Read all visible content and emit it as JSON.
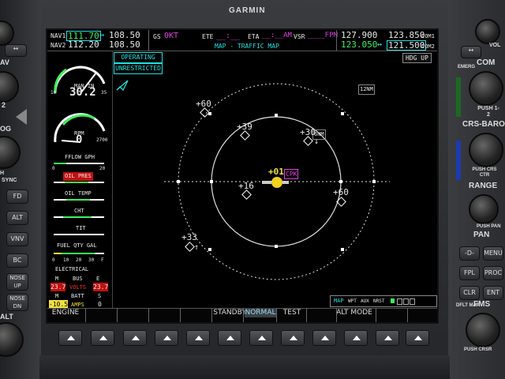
{
  "bezel": {
    "brand": "GARMIN",
    "left_knob_labels": [
      "AV",
      "2",
      "OG",
      "H",
      "SYNC",
      "ALT"
    ],
    "left_buttons": [
      "FD",
      "ALT",
      "VNV",
      "BC",
      "NOSE UP",
      "NOSE DN"
    ],
    "right_labels": {
      "vol": "VOL",
      "com": "COM",
      "emerg": "EMERG",
      "push_1_2": "PUSH 1-2",
      "crs_baro": "CRS-BARO",
      "push_crs_ctr": "PUSH CRS CTR",
      "range": "RANGE",
      "push_pan": "PUSH PAN",
      "fms": "FMS",
      "dflt_map": "DFLT MAP",
      "push_crsr": "PUSH CRSR"
    },
    "right_buttons": [
      "-D-",
      "MENU",
      "FPL",
      "PROC",
      "CLR",
      "ENT"
    ]
  },
  "topbar": {
    "nav1_label": "NAV1",
    "nav1_active": "111.70",
    "nav1_standby": "108.50",
    "nav2_label": "NAV2",
    "nav2_active": "112.20",
    "nav2_standby": "108.50",
    "gs_label": "GS",
    "gs_value": "0KT",
    "ete_label": "ETE",
    "ete_value": "__:__",
    "eta_label": "ETA",
    "eta_value": "__:__AM",
    "vsr_label": "VSR",
    "vsr_value": "____FPM",
    "com1_active": "127.900",
    "com1_standby": "123.850",
    "com1_label": "COM1",
    "com2_active": "123.050",
    "com2_standby": "121.500",
    "com2_label": "COM2",
    "map_title": "MAP - TRAFFIC MAP",
    "orientation": "HDG UP",
    "swap_arrow": "↔"
  },
  "traffic": {
    "status_operating": "OPERATING",
    "status_unrestricted": "UNRESTRICTED",
    "range_outer": "12NM",
    "range_inner": "6NM",
    "ownship_label": "+01",
    "ownship_id": "CPK",
    "targets": [
      {
        "alt": "+60",
        "arrow": ""
      },
      {
        "alt": "+39",
        "arrow": ""
      },
      {
        "alt": "+30",
        "arrow": "↓"
      },
      {
        "alt": "+16",
        "arrow": ""
      },
      {
        "alt": "+60",
        "arrow": ""
      },
      {
        "alt": "+33",
        "arrow": "↑"
      }
    ]
  },
  "eis": {
    "man_in_label": "MAN IN",
    "man_in_value": "30.2",
    "man_scale_min": "10",
    "man_scale_max": "35",
    "rpm_label": "RPM",
    "rpm_value": "0",
    "rpm_scale_max": "2700",
    "fflow_label": "FFLOW GPH",
    "fflow_scale": [
      "0",
      "20"
    ],
    "oil_pres_label": "OIL PRES",
    "oil_temp_label": "OIL TEMP",
    "cht_label": "CHT",
    "tit_label": "TIT",
    "fuel_qty_label": "FUEL QTY GAL",
    "fuel_scale": [
      "0",
      "10",
      "20",
      "30",
      "F"
    ],
    "electrical_label": "ELECTRICAL",
    "bus_m": "M",
    "bus_label": "BUS",
    "bus_e": "E",
    "volts_m": "23.7",
    "volts_label": "VOLTS",
    "volts_e": "23.7",
    "batt_m": "M",
    "batt_label": "BATT",
    "batt_s": "S",
    "amps_m": "-10.5",
    "amps_label": "AMPS",
    "amps_s": "0"
  },
  "map_footer": {
    "page_group": "MAP",
    "page_items": [
      "WPT",
      "AUX",
      "NRST"
    ]
  },
  "softkeys": [
    "ENGINE",
    "",
    "",
    "",
    "",
    "STANDBY",
    "NORMAL",
    "TEST",
    "",
    "ALT MODE",
    "",
    ""
  ],
  "colors": {
    "cyan": "#22e0e0",
    "green": "#3df05a",
    "magenta": "#e040e0",
    "yellow": "#f0e040",
    "red": "#ff3030"
  }
}
